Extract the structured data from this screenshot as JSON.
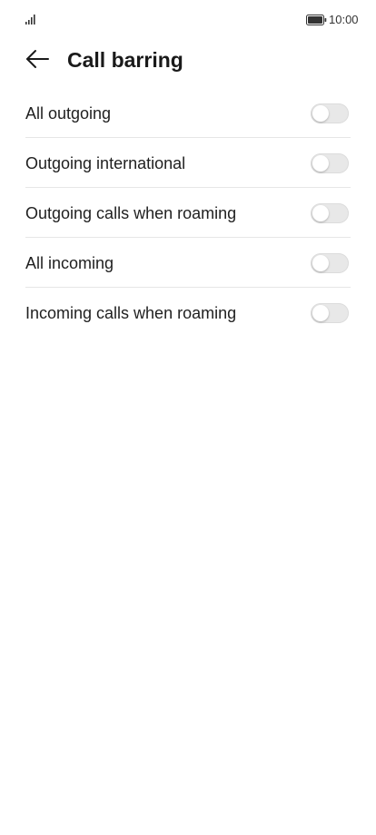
{
  "status_bar": {
    "time": "10:00",
    "signal_icon": "signal-icon",
    "battery_icon": "battery-icon"
  },
  "header": {
    "title": "Call barring",
    "back_icon": "arrow-left-icon"
  },
  "settings": {
    "items": [
      {
        "label": "All outgoing",
        "enabled": false
      },
      {
        "label": "Outgoing international",
        "enabled": false
      },
      {
        "label": "Outgoing calls when roaming",
        "enabled": false
      },
      {
        "label": "All incoming",
        "enabled": false
      },
      {
        "label": "Incoming calls when roaming",
        "enabled": false
      }
    ]
  },
  "colors": {
    "background": "#ffffff",
    "text": "#1a1a1a",
    "toggle_off": "#e8e8e8",
    "divider": "#e6e6e6"
  }
}
